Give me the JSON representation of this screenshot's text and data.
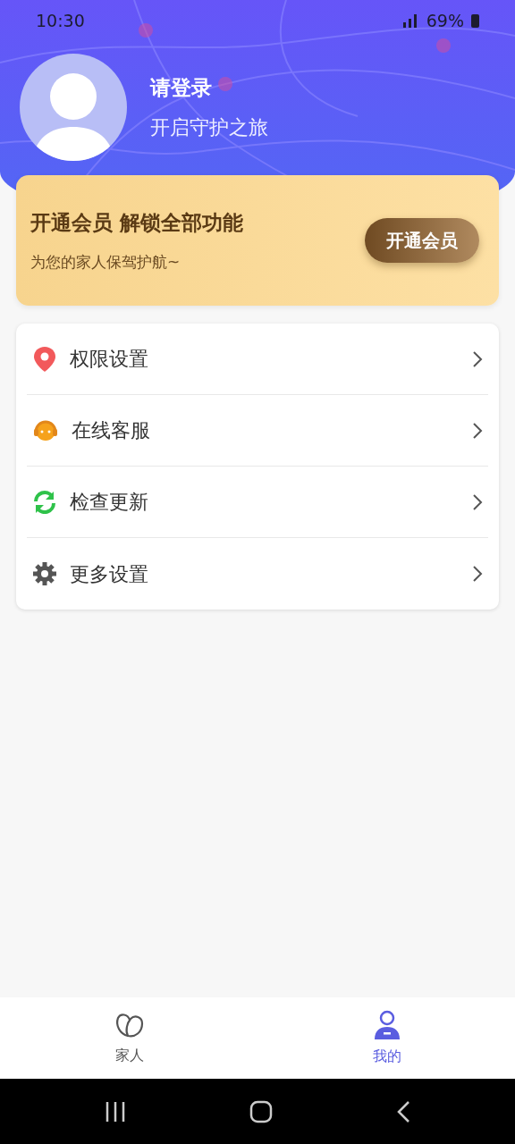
{
  "status_bar": {
    "time": "10:30",
    "battery": "69%"
  },
  "profile": {
    "title": "请登录",
    "subtitle": "开启守护之旅"
  },
  "vip_banner": {
    "title": "开通会员 解锁全部功能",
    "subtitle": "为您的家人保驾护航~",
    "button": "开通会员"
  },
  "menu": [
    {
      "kind": "permissions",
      "label": "权限设置"
    },
    {
      "kind": "service",
      "label": "在线客服"
    },
    {
      "kind": "update",
      "label": "检查更新"
    },
    {
      "kind": "settings",
      "label": "更多设置"
    }
  ],
  "tabs": [
    {
      "kind": "family",
      "label": "家人",
      "selected": false
    },
    {
      "kind": "mine",
      "label": "我的",
      "selected": true
    }
  ]
}
